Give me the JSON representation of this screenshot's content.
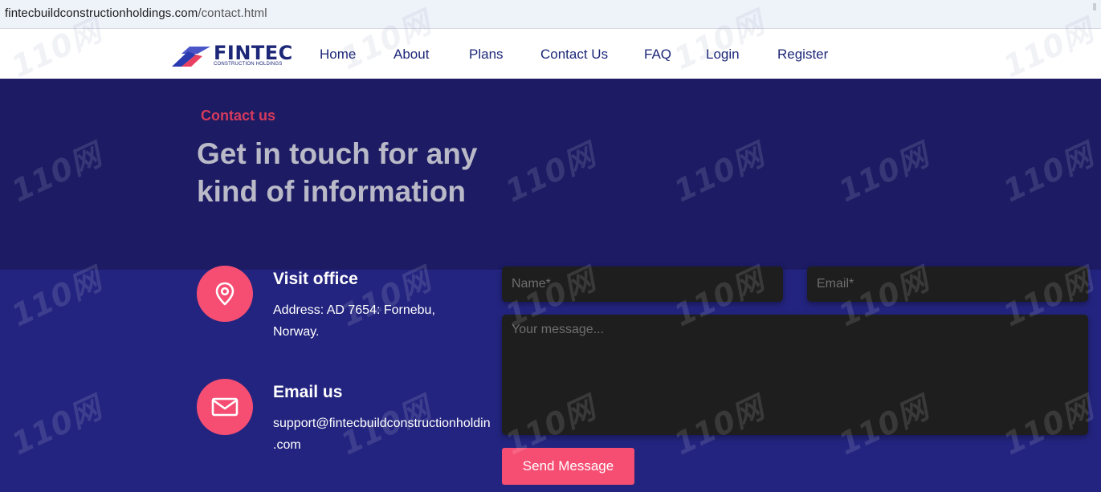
{
  "browser": {
    "url_domain": "fintecbuildconstructionholdings.com",
    "url_path": "/contact.html"
  },
  "navbar": {
    "logo_text": "FINTEC",
    "logo_subtext": "CONSTRUCTION HOLDINGS",
    "items": [
      "Home",
      "About",
      "Plans",
      "Contact Us",
      "FAQ",
      "Login",
      "Register"
    ]
  },
  "hero": {
    "eyebrow": "Contact us",
    "headline": "Get in touch for any kind of information"
  },
  "visit_office": {
    "title": "Visit office",
    "line1": "Address: AD 7654: Fornebu,",
    "line2": "Norway.",
    "icon": "location-pin-icon"
  },
  "email_us": {
    "title": "Email us",
    "line1": "support@fintecbuildconstructionholdin",
    "line2": ".com",
    "icon": "envelope-icon"
  },
  "form": {
    "name_placeholder": "Name*",
    "email_placeholder": "Email*",
    "message_placeholder": "Your message...",
    "submit_label": "Send Message"
  },
  "watermark_text": "110网",
  "colors": {
    "navy": "#1c1b63",
    "body_blue": "#23247f",
    "accent_pink": "#f64e73",
    "eyebrow_red": "#d63a5c"
  }
}
